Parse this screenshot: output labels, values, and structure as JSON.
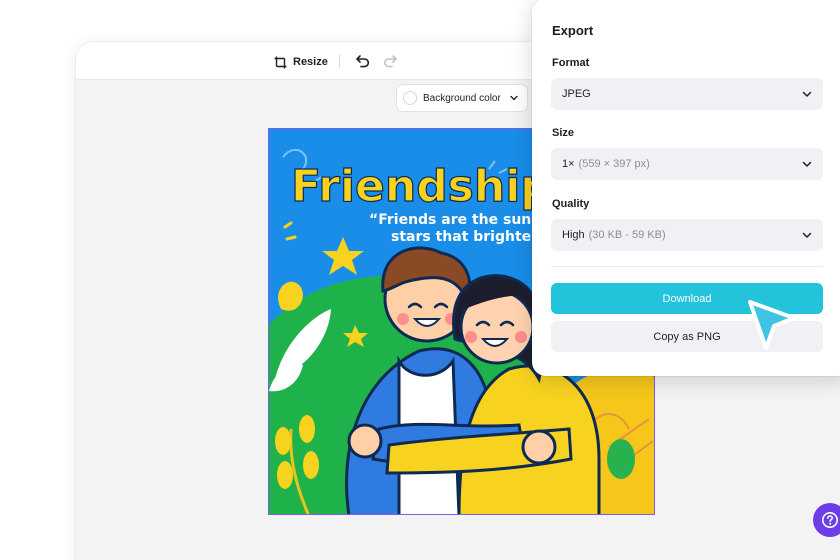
{
  "toolbar": {
    "resize_label": "Resize",
    "background_color_label": "Background color"
  },
  "artwork": {
    "title": "Friendship",
    "quote_line1": "“Friends are the sunsh",
    "quote_line2": "stars that brighten"
  },
  "export_panel": {
    "title": "Export",
    "format": {
      "label": "Format",
      "value": "JPEG"
    },
    "size": {
      "label": "Size",
      "value": "1×",
      "detail": "(559 × 397 px)"
    },
    "quality": {
      "label": "Quality",
      "value": "High",
      "detail": "(30 KB - 59 KB)"
    },
    "download_label": "Download",
    "copy_label": "Copy as PNG"
  },
  "colors": {
    "accent": "#23c3dc",
    "help": "#6c3fe6",
    "selection": "#7a5cf0"
  }
}
